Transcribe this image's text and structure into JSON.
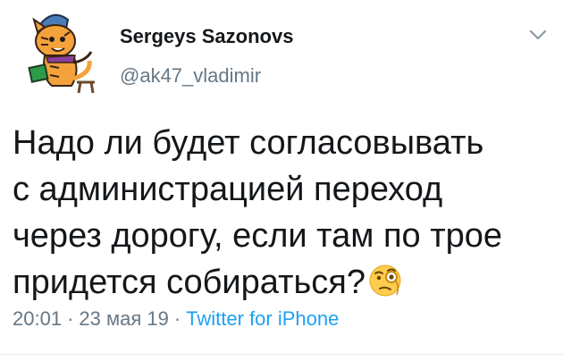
{
  "author": {
    "name": "Sergeys Sazonovs",
    "handle": "@ak47_vladimir"
  },
  "tweet": {
    "text": "Надо ли будет согласовывать\nс администрацией переход\nчерез дорогу, если там по трое\nпридется собираться?",
    "emoji": "face-with-monocle-icon"
  },
  "meta": {
    "time": "20:01",
    "separator": "·",
    "date": "23 мая 19",
    "source": "Twitter for iPhone"
  },
  "colors": {
    "text": "#14171a",
    "secondary": "#657786",
    "link": "#1da1f2"
  }
}
